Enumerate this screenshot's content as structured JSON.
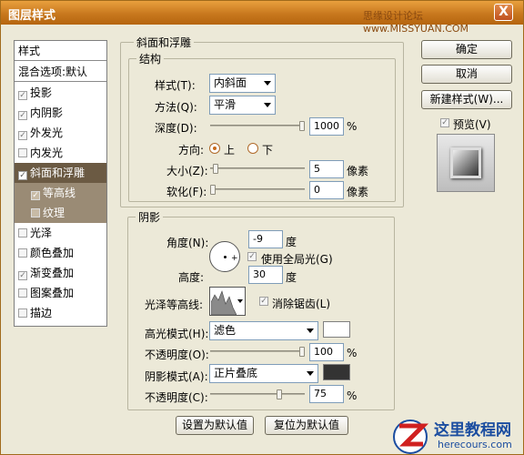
{
  "window": {
    "title": "图层样式",
    "watermark": "思缘设计论坛 www.MISSYUAN.COM",
    "close_glyph": "X"
  },
  "sidebar": {
    "header": "样式",
    "blend": "混合选项:默认",
    "items": [
      {
        "label": "投影",
        "checked": true
      },
      {
        "label": "内阴影",
        "checked": true
      },
      {
        "label": "外发光",
        "checked": true
      },
      {
        "label": "内发光",
        "checked": false
      },
      {
        "label": "斜面和浮雕",
        "checked": true
      },
      {
        "label": "等高线",
        "checked": true
      },
      {
        "label": "纹理",
        "checked": false
      },
      {
        "label": "光泽",
        "checked": false
      },
      {
        "label": "颜色叠加",
        "checked": false
      },
      {
        "label": "渐变叠加",
        "checked": true
      },
      {
        "label": "图案叠加",
        "checked": false
      },
      {
        "label": "描边",
        "checked": false
      }
    ]
  },
  "bevel": {
    "section_title": "斜面和浮雕",
    "structure_title": "结构",
    "style_label": "样式(T):",
    "style_value": "内斜面",
    "method_label": "方法(Q):",
    "method_value": "平滑",
    "depth_label": "深度(D):",
    "depth_value": "1000",
    "depth_unit": "%",
    "direction_label": "方向:",
    "dir_up": "上",
    "dir_down": "下",
    "size_label": "大小(Z):",
    "size_value": "5",
    "size_unit": "像素",
    "soften_label": "软化(F):",
    "soften_value": "0",
    "soften_unit": "像素"
  },
  "shading": {
    "title": "阴影",
    "angle_label": "角度(N):",
    "angle_value": "-9",
    "angle_unit": "度",
    "global_light": "使用全局光(G)",
    "altitude_label": "高度:",
    "altitude_value": "30",
    "altitude_unit": "度",
    "gloss_label": "光泽等高线:",
    "antialias": "消除锯齿(L)",
    "highlight_mode_label": "高光模式(H):",
    "highlight_mode_value": "滤色",
    "highlight_color": "#ffffff",
    "hl_opacity_label": "不透明度(O):",
    "hl_opacity_value": "100",
    "hl_opacity_unit": "%",
    "shadow_mode_label": "阴影模式(A):",
    "shadow_mode_value": "正片叠底",
    "shadow_color": "#333333",
    "sh_opacity_label": "不透明度(C):",
    "sh_opacity_value": "75",
    "sh_opacity_unit": "%"
  },
  "footer": {
    "set_default": "设置为默认值",
    "reset_default": "复位为默认值"
  },
  "actions": {
    "ok": "确定",
    "cancel": "取消",
    "new_style": "新建样式(W)...",
    "preview": "预览(V)"
  },
  "logo": {
    "name": "这里教程网",
    "url": "herecours.com"
  }
}
